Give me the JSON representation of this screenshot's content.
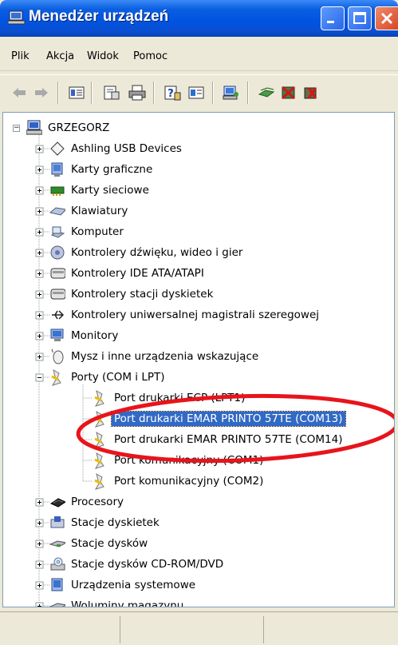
{
  "window": {
    "title": "Menedżer urządzeń"
  },
  "menu": [
    "Plik",
    "Akcja",
    "Widok",
    "Pomoc"
  ],
  "toolbar": {
    "icons": [
      "back-icon",
      "forward-icon",
      "show-hide-tree-icon",
      "properties-icon",
      "print-icon",
      "help-icon",
      "view-icon",
      "scan-hardware-icon",
      "update-driver-icon",
      "disable-device-icon",
      "uninstall-device-icon"
    ]
  },
  "tree": {
    "root": "GRZEGORZ",
    "categories": [
      "Ashling USB Devices",
      "Karty graficzne",
      "Karty sieciowe",
      "Klawiatury",
      "Komputer",
      "Kontrolery dźwięku, wideo i gier",
      "Kontrolery IDE ATA/ATAPI",
      "Kontrolery stacji dyskietek",
      "Kontrolery uniwersalnej magistrali szeregowej",
      "Monitory",
      "Mysz i inne urządzenia wskazujące",
      "Porty (COM i LPT)"
    ],
    "ports": [
      "Port drukarki ECP (LPT1)",
      "Port drukarki EMAR PRINTO 57TE (COM13)",
      "Port drukarki EMAR PRINTO 57TE (COM14)",
      "Port komunikacyjny (COM1)",
      "Port komunikacyjny (COM2)"
    ],
    "more_categories": [
      "Procesory",
      "Stacje dyskietek",
      "Stacje dysków",
      "Stacje dysków CD-ROM/DVD",
      "Urządzenia systemowe",
      "Woluminy magazynu"
    ],
    "selected": "Port drukarki EMAR PRINTO 57TE (COM13)"
  },
  "annotation": {
    "color": "#e8141b",
    "shape": "ellipse"
  }
}
